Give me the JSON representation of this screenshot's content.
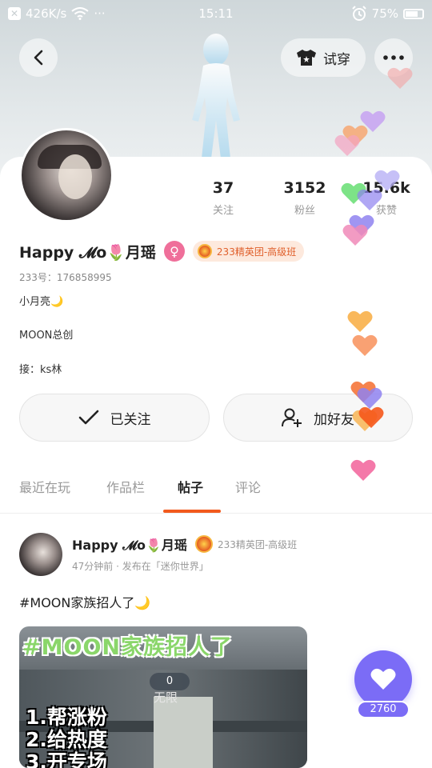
{
  "status_bar": {
    "network_speed": "426K/s",
    "dots": "···",
    "time": "15:11",
    "battery": "75%"
  },
  "top_actions": {
    "try_on_label": "试穿"
  },
  "profile": {
    "name": "Happy 𝓜o🌷月瑶",
    "gender_symbol": "♀",
    "badge_label": "233精英团-高级班",
    "uid": "233号：176858995",
    "bio_lines": [
      "小月亮🌙",
      "MOON总创",
      "接：ks林"
    ]
  },
  "stats": [
    {
      "value": "37",
      "label": "关注"
    },
    {
      "value": "3152",
      "label": "粉丝"
    },
    {
      "value": "15.6k",
      "label": "获赞"
    }
  ],
  "buttons": {
    "follow_label": "已关注",
    "add_friend_label": "加好友"
  },
  "tabs": [
    "最近在玩",
    "作品栏",
    "帖子",
    "评论"
  ],
  "post": {
    "author": "Happy 𝓜o🌷月瑶",
    "badge_label": "233精英团-高级班",
    "meta": "47分钟前 · 发布在「迷你世界」",
    "text": "#MOON家族招人了🌙",
    "image": {
      "title": "#MOON家族招人了",
      "counter": "0",
      "counter_label": "无限",
      "list": [
        "1.帮涨粉",
        "2.给热度",
        "3.开专场"
      ]
    }
  },
  "like": {
    "count": "2760"
  },
  "colors": {
    "accent_orange": "#f25a1d",
    "like_purple": "#7b6cf6",
    "gender_pink": "#ef6f9a",
    "badge_bg": "#fde9dd",
    "image_title_green": "#8ad66a"
  }
}
